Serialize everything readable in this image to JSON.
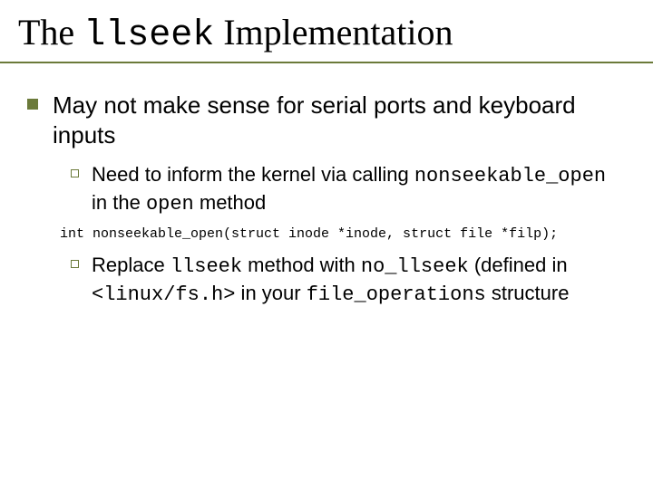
{
  "title": {
    "pre": "The ",
    "code": "llseek",
    "post": " Implementation"
  },
  "bullet1": "May not make sense for serial ports and keyboard inputs",
  "sub1": {
    "pre": "Need to inform the kernel via calling ",
    "code1": "nonseekable_open",
    "mid": " in the ",
    "code2": "open",
    "post": " method"
  },
  "codeline": "int nonseekable_open(struct inode *inode, struct file *filp);",
  "sub2": {
    "pre": "Replace ",
    "code1": "llseek",
    "mid1": " method with ",
    "code2": "no_llseek",
    "mid2": " (defined in ",
    "code3": "<linux/fs.h>",
    "mid3": " in your ",
    "code4": "file_operations",
    "post": " structure"
  }
}
